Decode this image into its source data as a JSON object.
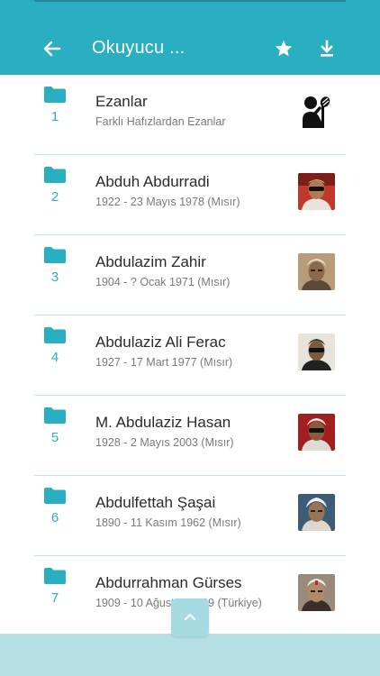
{
  "appbar": {
    "title": "Okuyucu ...",
    "back_icon": "arrow-left-icon",
    "favorite_icon": "star-icon",
    "download_icon": "download-icon"
  },
  "list": {
    "items": [
      {
        "number": "1",
        "name": "Ezanlar",
        "subtitle": "Farklı Hafızlardan Ezanlar",
        "thumb": "microphone-reader-icon"
      },
      {
        "number": "2",
        "name": "Abduh Abdurradi",
        "subtitle": "1922 - 23 Mayıs 1978 (Mısır)",
        "thumb": "portrait-photo"
      },
      {
        "number": "3",
        "name": "Abdulazim Zahir",
        "subtitle": "1904 - ? Ocak 1971 (Mısır)",
        "thumb": "portrait-photo"
      },
      {
        "number": "4",
        "name": "Abdulaziz Ali Ferac",
        "subtitle": "1927 - 17 Mart 1977 (Mısır)",
        "thumb": "portrait-photo"
      },
      {
        "number": "5",
        "name": "M. Abdulaziz Hasan",
        "subtitle": "1928 - 2 Mayıs 2003 (Mısır)",
        "thumb": "portrait-photo"
      },
      {
        "number": "6",
        "name": "Abdulfettah Şaşai",
        "subtitle": "1890 - 11 Kasım 1962 (Mısır)",
        "thumb": "portrait-photo"
      },
      {
        "number": "7",
        "name": "Abdurrahman Gürses",
        "subtitle": "1909 - 10 Ağustos 1999 (Türkiye)",
        "thumb": "portrait-photo"
      }
    ]
  },
  "scroll_top_icon": "chevron-up-icon",
  "colors": {
    "accent": "#2aaec2",
    "bottom_bar": "#b7dfe6"
  }
}
